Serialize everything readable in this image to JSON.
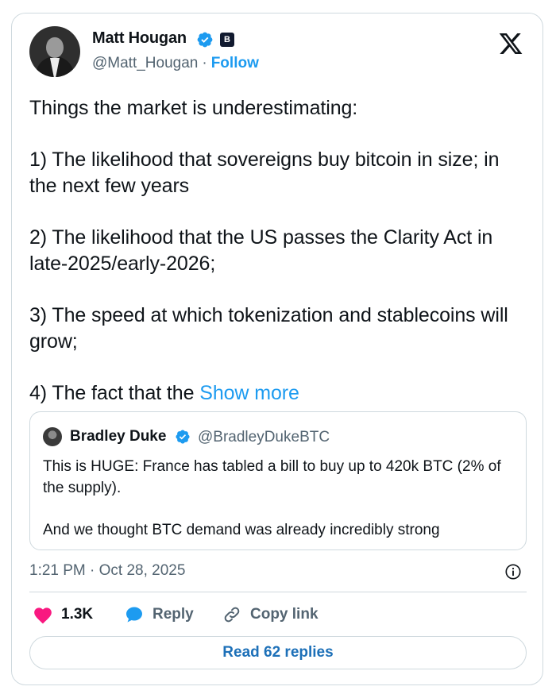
{
  "author": {
    "name": "Matt Hougan",
    "handle": "@Matt_Hougan",
    "separator": "·",
    "follow_label": "Follow",
    "affiliate_badge": "B"
  },
  "tweet": {
    "line1": "Things the market is underestimating:",
    "line2": "1) The likelihood that sovereigns buy bitcoin in size; in the next few years",
    "line3": "2) The likelihood that the US passes the Clarity Act in late-2025/early-2026;",
    "line4": "3) The speed at which tokenization and stablecoins will grow;",
    "line5": "4) The fact that the",
    "show_more": "Show more"
  },
  "quote": {
    "name": "Bradley Duke",
    "handle": "@BradleyDukeBTC",
    "line1": "This is HUGE: France has tabled a bill to buy up to 420k BTC (2% of the supply).",
    "line2": "And we thought BTC demand was already incredibly strong"
  },
  "meta": {
    "timestamp": "1:21 PM · Oct 28, 2025"
  },
  "actions": {
    "likes": "1.3K",
    "reply_label": "Reply",
    "copy_label": "Copy link",
    "read_replies": "Read 62 replies"
  },
  "colors": {
    "accent": "#1d9bf0",
    "like": "#f91880",
    "border": "#cfd9de",
    "muted": "#536471"
  }
}
